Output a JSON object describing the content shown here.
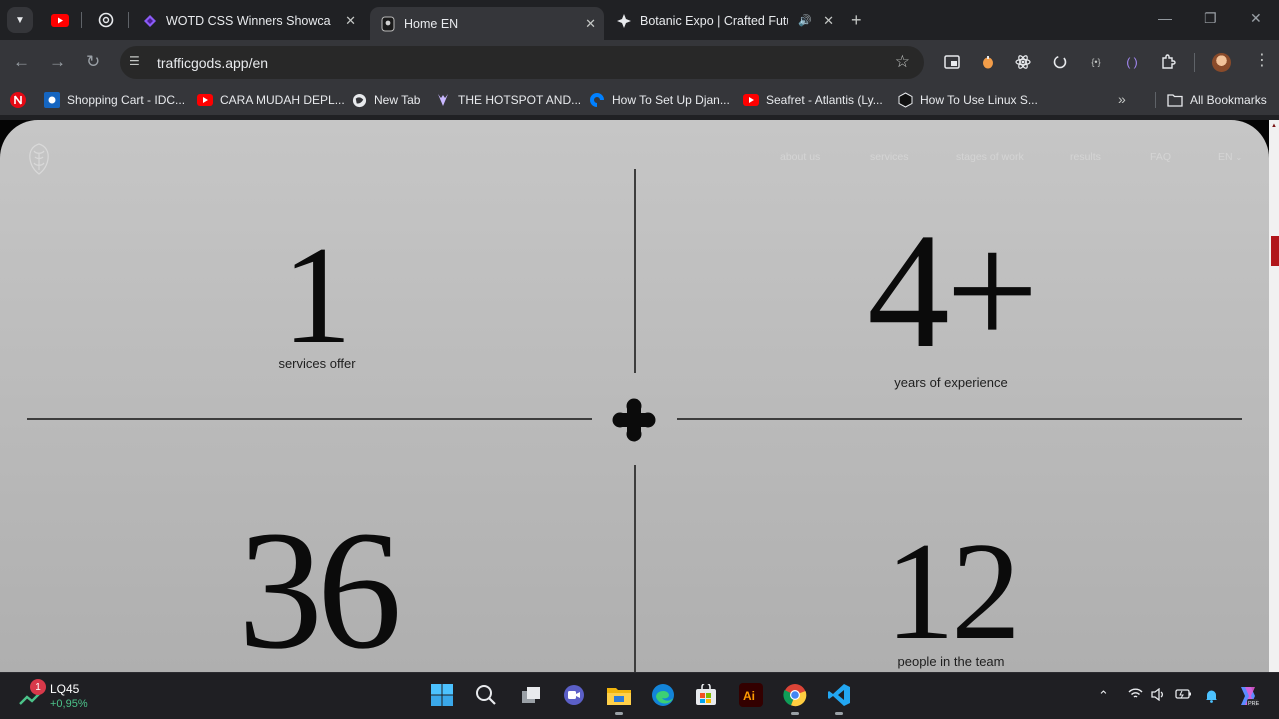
{
  "browser": {
    "tabs": [
      {
        "title": "",
        "icon": "youtube-icon",
        "pinned": true
      },
      {
        "title": "",
        "icon": "chatgpt-icon",
        "pinned": true
      },
      {
        "title": "WOTD CSS Winners Showcase -",
        "icon": "wotd-icon"
      },
      {
        "title": "Home EN",
        "icon": "trafficgods-icon",
        "active": true
      },
      {
        "title": "Botanic Expo | Crafted Futur",
        "icon": "botanic-icon",
        "audio": true
      }
    ],
    "url": "trafficgods.app/en",
    "bookmarks": [
      {
        "label": "",
        "icon": "netflix-icon"
      },
      {
        "label": "Shopping Cart - IDC...",
        "icon": "idc-icon"
      },
      {
        "label": "CARA MUDAH DEPL...",
        "icon": "youtube-icon"
      },
      {
        "label": "New Tab",
        "icon": "globe-icon"
      },
      {
        "label": "THE HOTSPOT AND...",
        "icon": "hotspot-icon"
      },
      {
        "label": "How To Set Up Djan...",
        "icon": "digitalocean-icon"
      },
      {
        "label": "Seafret - Atlantis (Ly...",
        "icon": "youtube-icon"
      },
      {
        "label": "How To Use Linux S...",
        "icon": "hexagon-icon"
      }
    ],
    "all_bookmarks": "All Bookmarks"
  },
  "site": {
    "nav": [
      "about us",
      "services",
      "stages of work",
      "results",
      "FAQ"
    ],
    "language": "EN",
    "stats": [
      {
        "value": "1",
        "label": "services offer"
      },
      {
        "value": "4+",
        "label": "years of experience"
      },
      {
        "value": "36",
        "label": ""
      },
      {
        "value": "12",
        "label": "people in the team"
      }
    ]
  },
  "taskbar": {
    "stock_badge": "1",
    "stock_name": "LQ45",
    "stock_change": "+0,95%"
  },
  "colors": {
    "accent": "#b1151a",
    "page_bg": "#c0c0c0",
    "chrome_bg": "#35363a"
  }
}
